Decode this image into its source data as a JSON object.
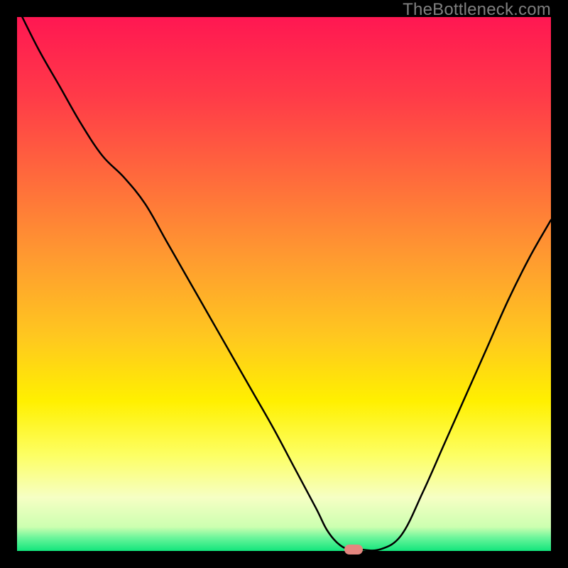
{
  "watermark": "TheBottleneck.com",
  "chart_data": {
    "type": "line",
    "title": "",
    "xlabel": "",
    "ylabel": "",
    "xlim": [
      0,
      100
    ],
    "ylim": [
      0,
      100
    ],
    "grid": false,
    "legend": false,
    "background_gradient": [
      {
        "stop": 0.0,
        "color": "#ff1752"
      },
      {
        "stop": 0.15,
        "color": "#ff3b48"
      },
      {
        "stop": 0.3,
        "color": "#ff6a3c"
      },
      {
        "stop": 0.45,
        "color": "#ff9a30"
      },
      {
        "stop": 0.6,
        "color": "#ffc81f"
      },
      {
        "stop": 0.72,
        "color": "#fff000"
      },
      {
        "stop": 0.82,
        "color": "#fdff63"
      },
      {
        "stop": 0.9,
        "color": "#f6ffc4"
      },
      {
        "stop": 0.955,
        "color": "#ccffb0"
      },
      {
        "stop": 0.975,
        "color": "#6cf59b"
      },
      {
        "stop": 1.0,
        "color": "#12e57c"
      }
    ],
    "series": [
      {
        "name": "bottleneck-curve",
        "color": "#000000",
        "x": [
          0,
          4,
          8,
          12,
          16,
          20,
          24,
          28,
          32,
          36,
          40,
          44,
          48,
          52,
          56,
          58,
          60,
          62,
          64,
          68,
          72,
          76,
          80,
          84,
          88,
          92,
          96,
          100
        ],
        "y": [
          102,
          94,
          87,
          80,
          74,
          70,
          65,
          58,
          51,
          44,
          37,
          30,
          23,
          15.5,
          8,
          4,
          1.5,
          0.3,
          0.3,
          0.3,
          3,
          11,
          20,
          29,
          38,
          47,
          55,
          62
        ]
      }
    ],
    "marker": {
      "x": 63,
      "y": 0.3,
      "color": "#e4867f"
    }
  }
}
